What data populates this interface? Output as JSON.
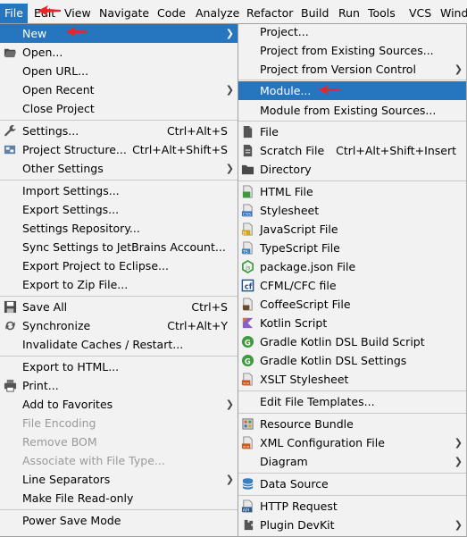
{
  "menubar": {
    "file": "File",
    "edit": "Edit",
    "view": "View",
    "navigate": "Navigate",
    "code": "Code",
    "analyze": "Analyze",
    "refactor": "Refactor",
    "build": "Build",
    "run": "Run",
    "tools": "Tools",
    "vcs": "VCS",
    "window": "Wind"
  },
  "file_menu": {
    "new": "New",
    "open": "Open...",
    "open_url": "Open URL...",
    "open_recent": "Open Recent",
    "close_project": "Close Project",
    "settings": "Settings...",
    "settings_sc": "Ctrl+Alt+S",
    "project_structure": "Project Structure...",
    "project_structure_sc": "Ctrl+Alt+Shift+S",
    "other_settings": "Other Settings",
    "import_settings": "Import Settings...",
    "export_settings": "Export Settings...",
    "settings_repository": "Settings Repository...",
    "sync_settings": "Sync Settings to JetBrains Account...",
    "export_eclipse": "Export Project to Eclipse...",
    "export_zip": "Export to Zip File...",
    "save_all": "Save All",
    "save_all_sc": "Ctrl+S",
    "synchronize": "Synchronize",
    "synchronize_sc": "Ctrl+Alt+Y",
    "invalidate_caches": "Invalidate Caches / Restart...",
    "export_html": "Export to HTML...",
    "print": "Print...",
    "add_favorites": "Add to Favorites",
    "file_encoding": "File Encoding",
    "remove_bom": "Remove BOM",
    "associate_file_type": "Associate with File Type...",
    "line_separators": "Line Separators",
    "make_readonly": "Make File Read-only",
    "power_save": "Power Save Mode"
  },
  "new_submenu": {
    "project": "Project...",
    "project_existing": "Project from Existing Sources...",
    "project_vcs": "Project from Version Control",
    "module": "Module...",
    "module_existing": "Module from Existing Sources...",
    "file": "File",
    "scratch_file": "Scratch File",
    "scratch_file_sc": "Ctrl+Alt+Shift+Insert",
    "directory": "Directory",
    "html_file": "HTML File",
    "stylesheet": "Stylesheet",
    "javascript_file": "JavaScript File",
    "typescript_file": "TypeScript File",
    "package_json": "package.json File",
    "cfml_file": "CFML/CFC file",
    "coffeescript_file": "CoffeeScript File",
    "kotlin_script": "Kotlin Script",
    "gradle_build_script": "Gradle Kotlin DSL Build Script",
    "gradle_settings": "Gradle Kotlin DSL Settings",
    "xslt_stylesheet": "XSLT Stylesheet",
    "edit_templates": "Edit File Templates...",
    "resource_bundle": "Resource Bundle",
    "xml_config": "XML Configuration File",
    "diagram": "Diagram",
    "data_source": "Data Source",
    "http_request": "HTTP Request",
    "plugin_devkit": "Plugin DevKit"
  },
  "colors": {
    "selection": "#2675bf",
    "menu_bg": "#f2f2f2",
    "annotation": "#e8252b",
    "disabled": "#9a9a9a"
  }
}
